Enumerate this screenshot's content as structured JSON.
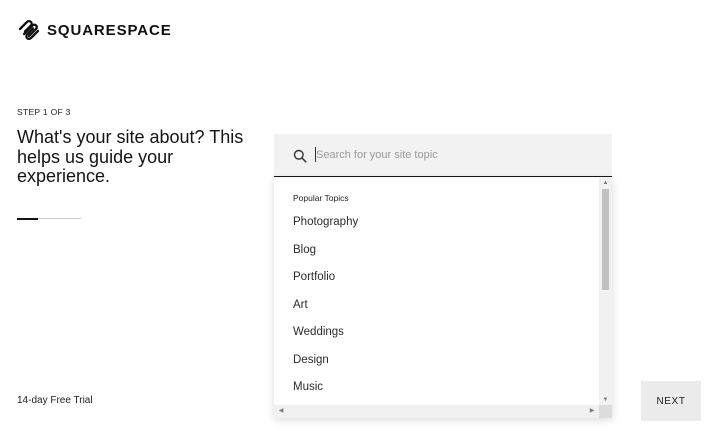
{
  "brand": {
    "name": "SQUARESPACE",
    "logo_icon": "squarespace-logo-icon"
  },
  "intro": {
    "step": "STEP 1 OF 3",
    "title": "What's your site about? This helps us guide your experience.",
    "progress_fraction": 0.333,
    "trial": "14-day Free Trial"
  },
  "search": {
    "icon": "search-icon",
    "placeholder": "Search for your site topic",
    "value": ""
  },
  "dropdown": {
    "header": "Popular Topics",
    "items": [
      "Photography",
      "Blog",
      "Portfolio",
      "Art",
      "Weddings",
      "Design",
      "Music"
    ]
  },
  "actions": {
    "next_label": "NEXT"
  },
  "colors": {
    "text": "#1a1a1a",
    "field_bg": "#f2f2f2",
    "button_bg": "#ebebeb"
  }
}
